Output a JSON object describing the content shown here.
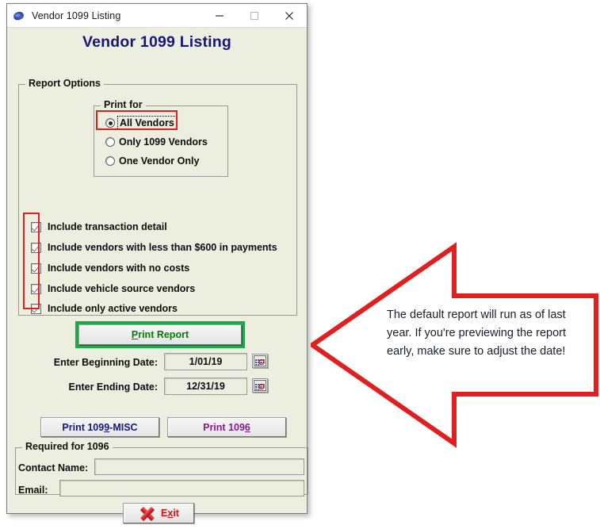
{
  "window": {
    "title": "Vendor 1099 Listing",
    "app_icon": "globe-icon",
    "controls": {
      "minimize": "minimize-icon",
      "maximize": "maximize-icon",
      "close": "close-icon"
    }
  },
  "heading": "Vendor 1099 Listing",
  "report_options": {
    "legend": "Report Options",
    "print_for": {
      "legend": "Print for",
      "options": [
        {
          "label": "All Vendors",
          "selected": true,
          "focused": true
        },
        {
          "label": "Only 1099 Vendors",
          "selected": false,
          "focused": false
        },
        {
          "label": "One Vendor Only",
          "selected": false,
          "focused": false
        }
      ]
    },
    "checkboxes": [
      {
        "label": "Include transaction detail",
        "checked": true
      },
      {
        "label": "Include vendors with less than $600 in payments",
        "checked": true
      },
      {
        "label": "Include vendors with no costs",
        "checked": true
      },
      {
        "label": "Include vehicle source vendors",
        "checked": true
      },
      {
        "label": "Include only active vendors",
        "checked": true
      }
    ]
  },
  "actions": {
    "print_report": "Print Report",
    "print_1099_misc": "Print 1099-MISC",
    "print_1096": "Print 1096",
    "exit": "Exit"
  },
  "dates": {
    "begin_label": "Enter Beginning Date:",
    "begin_value": "1/01/19",
    "end_label": "Enter Ending Date:",
    "end_value": "12/31/19",
    "calendar_icon": "calendar-icon"
  },
  "required_1096": {
    "legend": "Required for 1096",
    "contact_label": "Contact Name:",
    "contact_value": "",
    "email_label": "Email:",
    "email_value": ""
  },
  "callout": {
    "text": "The default report will run as of last year. If you're previewing the report early, make sure to adjust the date!",
    "color": "#E02020"
  },
  "highlight_colors": {
    "red": "#E02020",
    "green": "#1DA74B"
  }
}
